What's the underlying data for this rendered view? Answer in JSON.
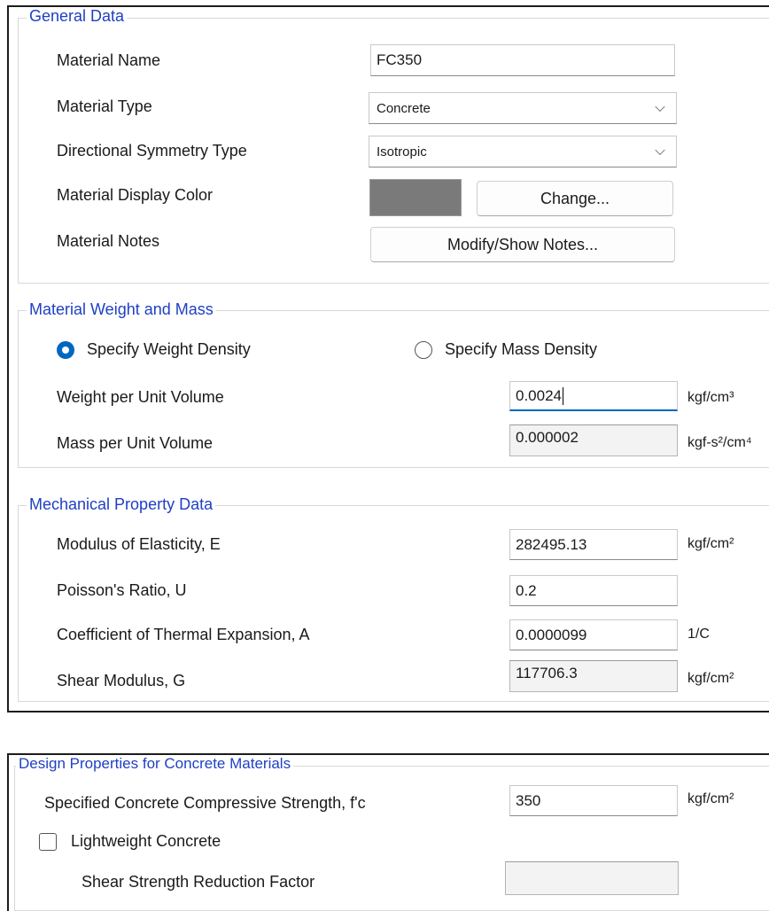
{
  "general": {
    "legend": "General Data",
    "material_name_label": "Material Name",
    "material_name_value": "FC350",
    "material_type_label": "Material Type",
    "material_type_value": "Concrete",
    "symmetry_label": "Directional Symmetry Type",
    "symmetry_value": "Isotropic",
    "display_color_label": "Material Display Color",
    "display_color": "#7a7a7a",
    "change_button": "Change...",
    "notes_label": "Material Notes",
    "notes_button": "Modify/Show Notes..."
  },
  "weight_mass": {
    "legend": "Material Weight and Mass",
    "specify_weight_label": "Specify Weight Density",
    "specify_weight_selected": true,
    "specify_mass_label": "Specify Mass Density",
    "specify_mass_selected": false,
    "weight_label": "Weight per Unit Volume",
    "weight_value": "0.0024",
    "weight_unit": "kgf/cm³",
    "mass_label": "Mass per Unit Volume",
    "mass_value": "0.000002",
    "mass_unit": "kgf-s²/cm⁴"
  },
  "mechanical": {
    "legend": "Mechanical Property Data",
    "e_label": "Modulus of Elasticity,  E",
    "e_value": "282495.13",
    "e_unit": "kgf/cm²",
    "poisson_label": "Poisson's Ratio,  U",
    "poisson_value": "0.2",
    "thermal_label": "Coefficient of Thermal Expansion,  A",
    "thermal_value": "0.0000099",
    "thermal_unit": "1/C",
    "shear_label": "Shear Modulus,  G",
    "shear_value": "117706.3",
    "shear_unit": "kgf/cm²"
  },
  "design": {
    "legend": "Design Properties for Concrete Materials",
    "fc_label": "Specified Concrete Compressive Strength, f'c",
    "fc_value": "350",
    "fc_unit": "kgf/cm²",
    "lightweight_label": "Lightweight Concrete",
    "lightweight_checked": false,
    "shear_reduction_label": "Shear Strength Reduction Factor",
    "shear_reduction_value": ""
  },
  "colors": {
    "accent": "#0067c0",
    "legend_text": "#1f40c4"
  },
  "icons": {
    "combo_arrow": "chevron-down-icon"
  }
}
